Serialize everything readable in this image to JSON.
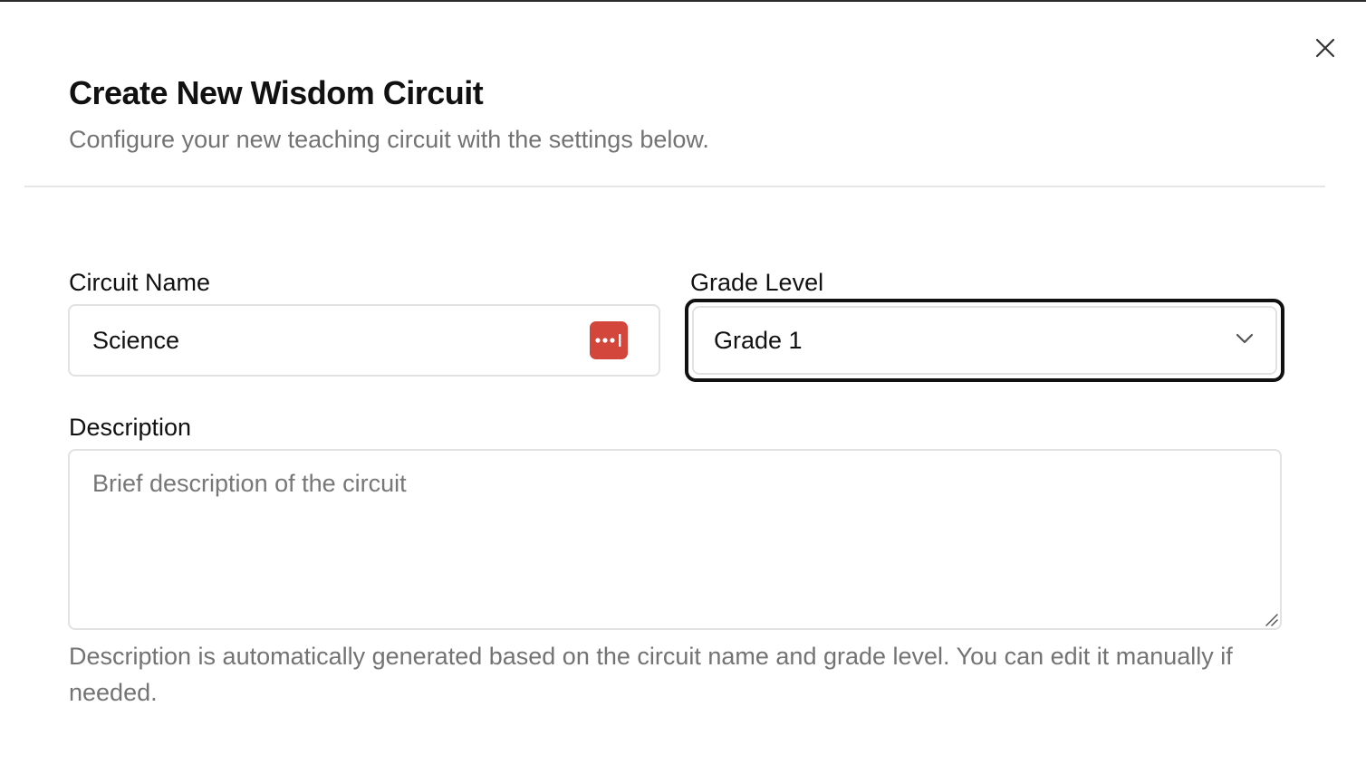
{
  "dialog": {
    "title": "Create New Wisdom Circuit",
    "subtitle": "Configure your new teaching circuit with the settings below.",
    "close_icon": "close-icon"
  },
  "form": {
    "circuit_name": {
      "label": "Circuit Name",
      "value": "Science",
      "password_manager_icon": "password-manager-icon",
      "password_manager_color": "#d2463c"
    },
    "grade_level": {
      "label": "Grade Level",
      "selected": "Grade 1",
      "icon": "chevron-down-icon"
    },
    "description": {
      "label": "Description",
      "value": "",
      "placeholder": "Brief description of the circuit",
      "help": "Description is automatically generated based on the circuit name and grade level. You can edit it manually if needed."
    }
  },
  "colors": {
    "focus_ring": "#111111",
    "border": "#e2e2e2",
    "muted_text": "#737373"
  }
}
